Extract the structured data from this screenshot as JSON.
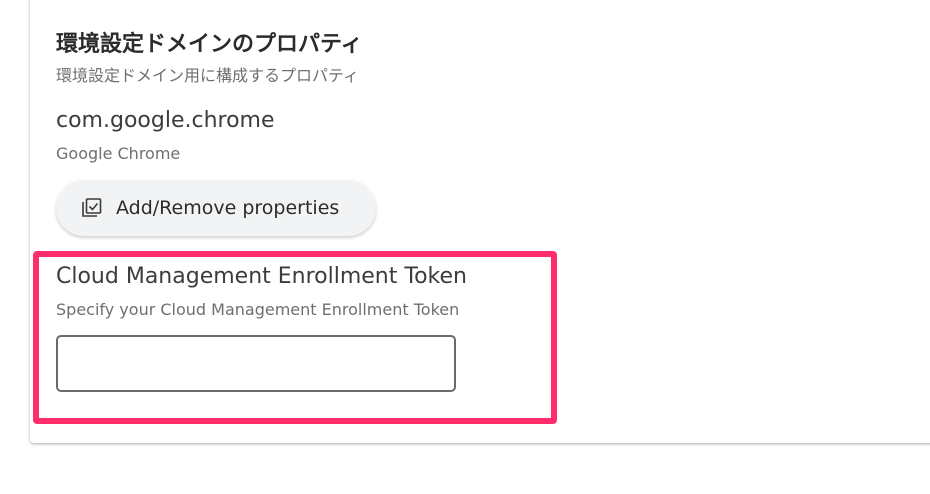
{
  "section": {
    "title": "環境設定ドメインのプロパティ",
    "subtitle": "環境設定ドメイン用に構成するプロパティ"
  },
  "domain": {
    "name": "com.google.chrome",
    "description": "Google Chrome"
  },
  "actions": {
    "add_remove_label": "Add/Remove properties",
    "add_remove_icon": "checklist-icon"
  },
  "field": {
    "title": "Cloud Management Enrollment Token",
    "description": "Specify your Cloud Management Enrollment Token",
    "value": "",
    "placeholder": ""
  },
  "colors": {
    "highlight": "#ff2d6c",
    "button_bg": "#f1f3f5"
  }
}
